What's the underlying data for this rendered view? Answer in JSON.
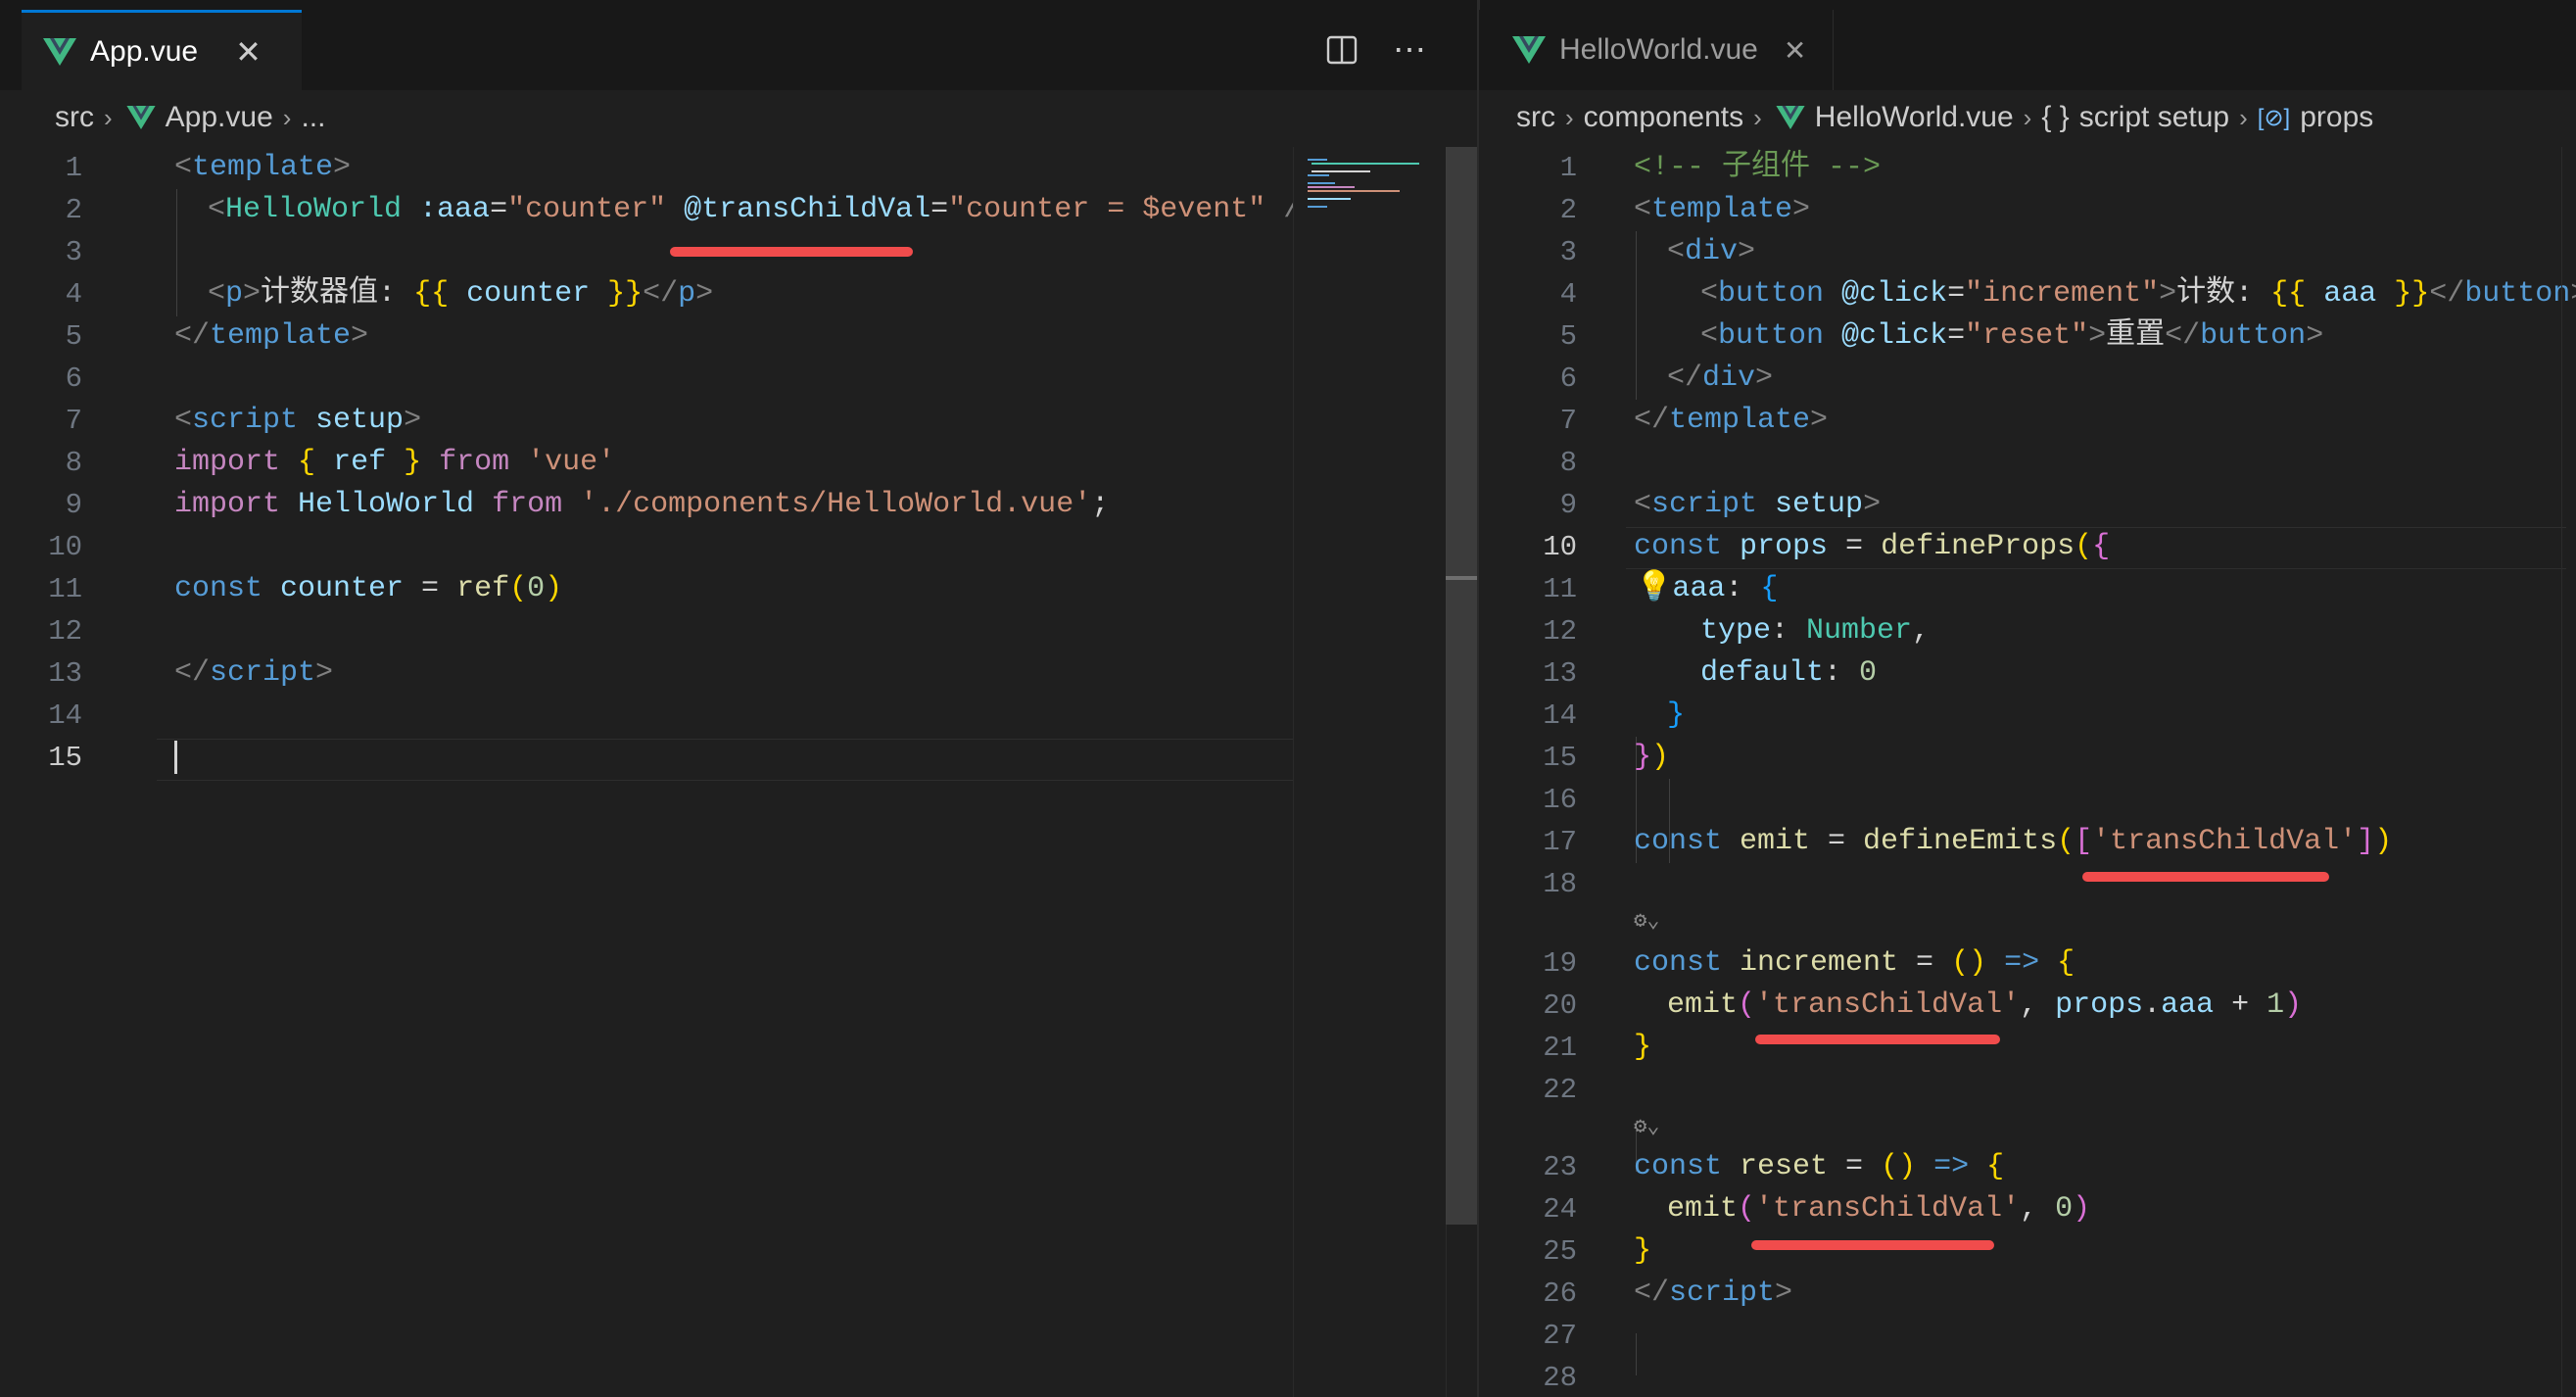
{
  "left_editor": {
    "tab": {
      "label": "App.vue",
      "close": "✕"
    },
    "actions": {
      "more": "⋯"
    },
    "breadcrumb": [
      "src",
      "App.vue",
      "..."
    ],
    "lines": [
      {
        "n": "1"
      },
      {
        "n": "2"
      },
      {
        "n": "3"
      },
      {
        "n": "4"
      },
      {
        "n": "5"
      },
      {
        "n": "6"
      },
      {
        "n": "7"
      },
      {
        "n": "8"
      },
      {
        "n": "9"
      },
      {
        "n": "10"
      },
      {
        "n": "11"
      },
      {
        "n": "12"
      },
      {
        "n": "13"
      },
      {
        "n": "14"
      },
      {
        "n": "15"
      }
    ],
    "tokens": {
      "l1": [
        "<",
        "template",
        ">"
      ],
      "l2": [
        "<",
        "HelloWorld",
        " :aaa",
        "=",
        "\"counter\"",
        " @transChildVal",
        "=",
        "\"counter = $event\"",
        " />"
      ],
      "l4": [
        "<",
        "p",
        ">",
        "计数器值: ",
        "{{",
        " counter ",
        "}}",
        "</",
        "p",
        ">"
      ],
      "l5": [
        "</",
        "template",
        ">"
      ],
      "l7": [
        "<",
        "script",
        " setup",
        ">"
      ],
      "l8": [
        "import",
        " ",
        "{",
        " ref ",
        "}",
        " from ",
        "'vue'"
      ],
      "l9": [
        "import",
        " HelloWorld ",
        "from",
        " ",
        "'./components/HelloWorld.vue'",
        ";"
      ],
      "l11": [
        "const",
        " counter",
        " = ",
        "ref",
        "(",
        "0",
        ")"
      ],
      "l13": [
        "</",
        "script",
        ">"
      ]
    }
  },
  "right_editor": {
    "tab": {
      "label": "HelloWorld.vue",
      "close": "✕"
    },
    "breadcrumb": [
      "src",
      "components",
      "HelloWorld.vue",
      "script setup",
      "props"
    ],
    "breadcrumb_icons": {
      "braces": "{ }",
      "prop": "[⊘]"
    },
    "lines": [
      {
        "n": "1"
      },
      {
        "n": "2"
      },
      {
        "n": "3"
      },
      {
        "n": "4"
      },
      {
        "n": "5"
      },
      {
        "n": "6"
      },
      {
        "n": "7"
      },
      {
        "n": "8"
      },
      {
        "n": "9"
      },
      {
        "n": "10"
      },
      {
        "n": "11"
      },
      {
        "n": "12"
      },
      {
        "n": "13"
      },
      {
        "n": "14"
      },
      {
        "n": "15"
      },
      {
        "n": "16"
      },
      {
        "n": "17"
      },
      {
        "n": "18"
      },
      {
        "n": "19"
      },
      {
        "n": "20"
      },
      {
        "n": "21"
      },
      {
        "n": "22"
      },
      {
        "n": "23"
      },
      {
        "n": "24"
      },
      {
        "n": "25"
      },
      {
        "n": "26"
      },
      {
        "n": "27"
      },
      {
        "n": "28"
      }
    ],
    "codelens": "⚙⌄",
    "tokens": {
      "l1": [
        "<!-- 子组件 -->"
      ],
      "l2": [
        "<",
        "template",
        ">"
      ],
      "l3": [
        "<",
        "div",
        ">"
      ],
      "l4": [
        "<",
        "button",
        " @click",
        "=",
        "\"increment\"",
        ">",
        "计数: ",
        "{{",
        " aaa ",
        "}}",
        "</",
        "button",
        ">"
      ],
      "l5": [
        "<",
        "button",
        " @click",
        "=",
        "\"reset\"",
        ">",
        "重置",
        "</",
        "button",
        ">"
      ],
      "l6": [
        "</",
        "div",
        ">"
      ],
      "l7": [
        "</",
        "template",
        ">"
      ],
      "l9": [
        "<",
        "script",
        " setup",
        ">"
      ],
      "l10": [
        "const",
        " props",
        " = ",
        "defineProps",
        "(",
        "{"
      ],
      "l11": [
        "💡",
        "aaa",
        ": ",
        "{"
      ],
      "l12": [
        "type",
        ": ",
        "Number",
        ","
      ],
      "l13": [
        "default",
        ": ",
        "0"
      ],
      "l14": [
        "}"
      ],
      "l15": [
        "}",
        ")"
      ],
      "l17": [
        "const",
        " emit",
        " = ",
        "defineEmits",
        "(",
        "[",
        "'transChildVal'",
        "]",
        ")"
      ],
      "l19": [
        "const",
        " increment",
        " = ",
        "()",
        " => ",
        "{"
      ],
      "l20": [
        "emit",
        "(",
        "'transChildVal'",
        ", ",
        "props",
        ".",
        "aaa",
        " + ",
        "1",
        ")"
      ],
      "l21": [
        "}"
      ],
      "l23": [
        "const",
        " reset",
        " = ",
        "()",
        " => ",
        "{"
      ],
      "l24": [
        "emit",
        "(",
        "'transChildVal'",
        ", ",
        "0",
        ")"
      ],
      "l25": [
        "}"
      ],
      "l26": [
        "</",
        "script",
        ">"
      ]
    }
  },
  "colors": {
    "accent": "#0078d4",
    "underline": "#f14c4c",
    "background": "#1f1f1f"
  }
}
